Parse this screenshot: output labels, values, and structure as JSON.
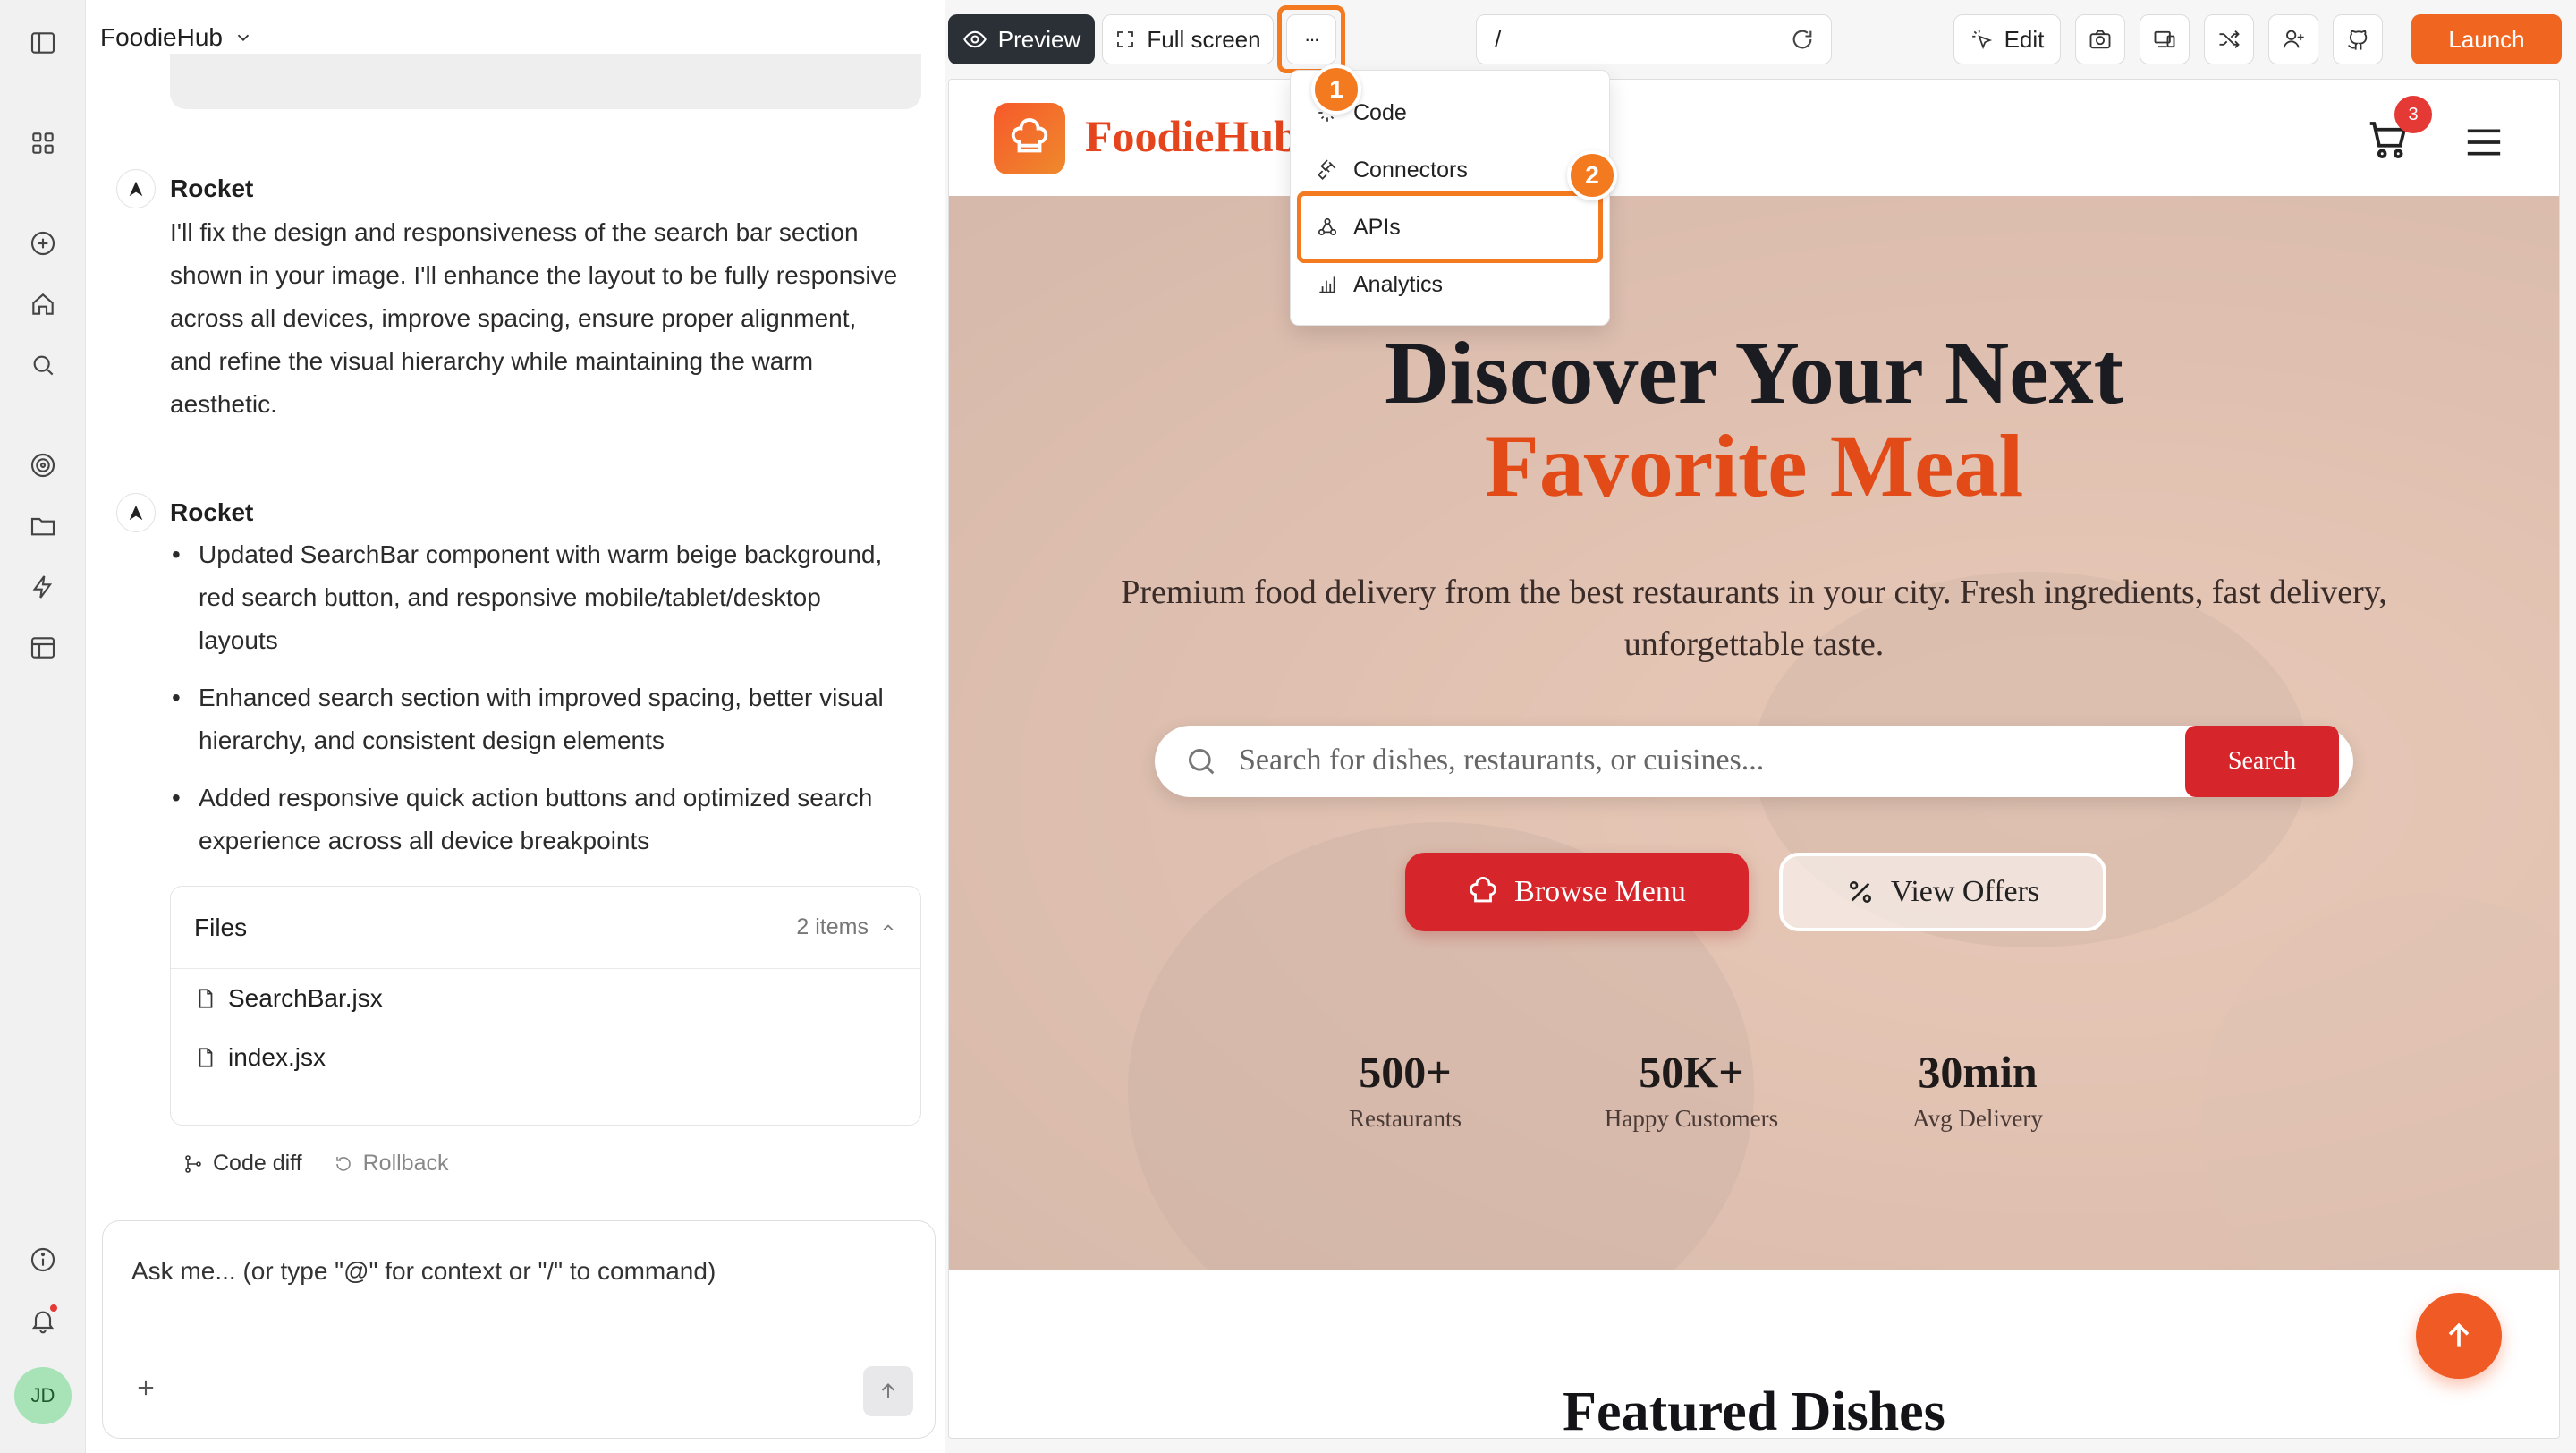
{
  "app": {
    "project_name": "FoodieHub"
  },
  "chat": {
    "messages": [
      {
        "author": "Rocket",
        "text": "I'll fix the design and responsiveness of the search bar section shown in your image. I'll enhance the layout to be fully responsive across all devices, improve spacing, ensure proper alignment, and refine the visual hierarchy while maintaining the warm aesthetic."
      },
      {
        "author": "Rocket",
        "bullets": [
          "Updated SearchBar component with warm beige background, red search button, and responsive mobile/tablet/desktop layouts",
          "Enhanced search section with improved spacing, better visual hierarchy, and consistent design elements",
          "Added responsive quick action buttons and optimized search experience across all device breakpoints"
        ]
      }
    ],
    "files": {
      "title": "Files",
      "count": "2 items",
      "items": [
        "SearchBar.jsx",
        "index.jsx"
      ]
    },
    "actions": {
      "code_diff": "Code diff",
      "rollback": "Rollback"
    },
    "composer": {
      "placeholder": "Ask me... (or type \"@\" for context or \"/\" to command)"
    }
  },
  "toolbar": {
    "preview": "Preview",
    "full_screen": "Full screen",
    "more": "···",
    "url": "/",
    "edit": "Edit",
    "launch": "Launch"
  },
  "dropdown": {
    "items": [
      "Code",
      "Connectors",
      "APIs",
      "Analytics"
    ]
  },
  "steps": [
    "1",
    "2"
  ],
  "site": {
    "brand": "FoodieHub",
    "cart_count": "3",
    "hero": {
      "title_line1": "Discover Your Next",
      "title_line2": "Favorite Meal",
      "subtitle": "Premium food delivery from the best restaurants in your city. Fresh ingredients, fast delivery, unforgettable taste.",
      "search_placeholder": "Search for dishes, restaurants, or cuisines...",
      "search_button": "Search",
      "browse_menu": "Browse Menu",
      "view_offers": "View Offers",
      "stats": [
        {
          "value": "500+",
          "label": "Restaurants"
        },
        {
          "value": "50K+",
          "label": "Happy Customers"
        },
        {
          "value": "30min",
          "label": "Avg Delivery"
        }
      ]
    },
    "featured_heading": "Featured Dishes"
  },
  "user": {
    "initials": "JD"
  },
  "colors": {
    "accent": "#f0651f",
    "highlight": "#f47a20",
    "brand_red": "#d7262b"
  }
}
